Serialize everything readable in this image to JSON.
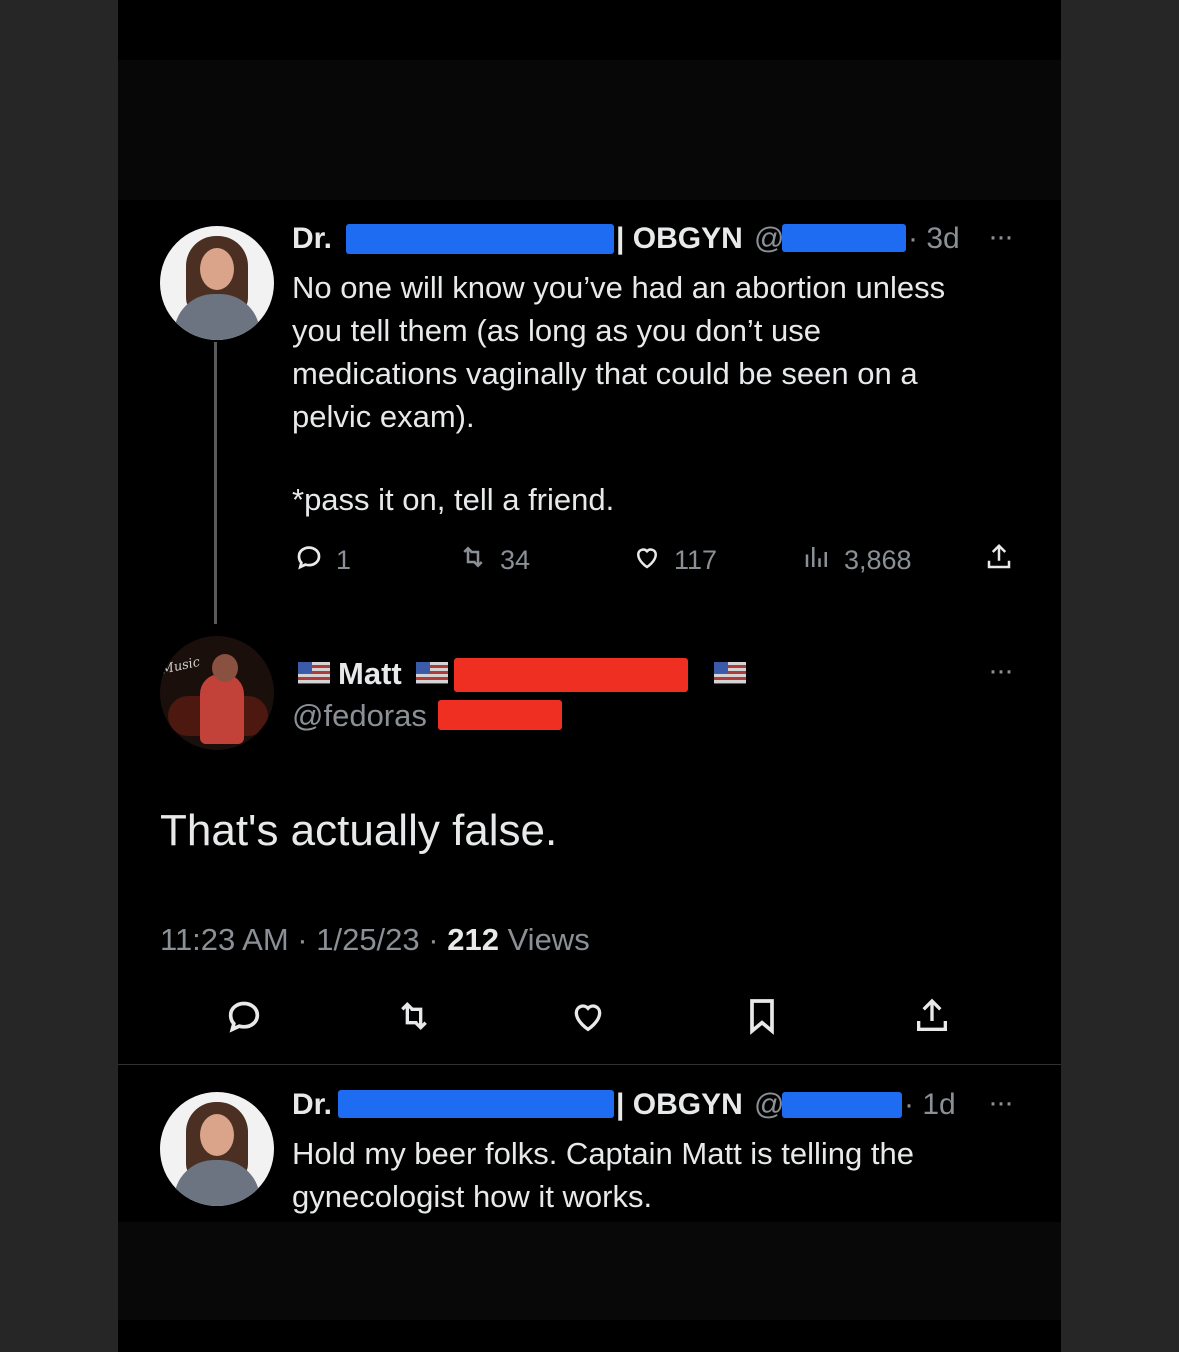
{
  "tweet1": {
    "name_prefix": "Dr.",
    "name_suffix": "| OBGYN",
    "handle_prefix": "@",
    "time": "· 3d",
    "more": "···",
    "body_lines": [
      "No one will know you’ve had an abortion unless",
      "you tell them (as long as you don’t use",
      "medications vaginally that could be seen on a",
      "pelvic exam)."
    ],
    "body_extra": "*pass it on, tell a friend.",
    "replies": "1",
    "retweets": "34",
    "likes": "117",
    "views": "3,868"
  },
  "main_tweet": {
    "name": "Matt",
    "handle": "@fedoras",
    "more": "···",
    "text": "That's actually false.",
    "meta_time": "11:23 AM · 1/25/23 · ",
    "meta_views_count": "212",
    "meta_views_label": " Views"
  },
  "tweet2": {
    "name_prefix": "Dr.",
    "name_suffix": "| OBGYN",
    "handle_prefix": "@",
    "time": "· 1d",
    "more": "···",
    "body_lines": [
      "Hold my beer folks. Captain Matt is telling the",
      "gynecologist how it works."
    ]
  },
  "colors": {
    "background": "#000000",
    "text": "#e7e9ea",
    "muted": "#8b9096",
    "redact_blue": "#1d6cf2",
    "redact_red": "#ef2f22"
  },
  "icons": [
    "reply-icon",
    "retweet-icon",
    "like-icon",
    "views-icon",
    "share-icon",
    "bookmark-icon",
    "more-icon"
  ]
}
